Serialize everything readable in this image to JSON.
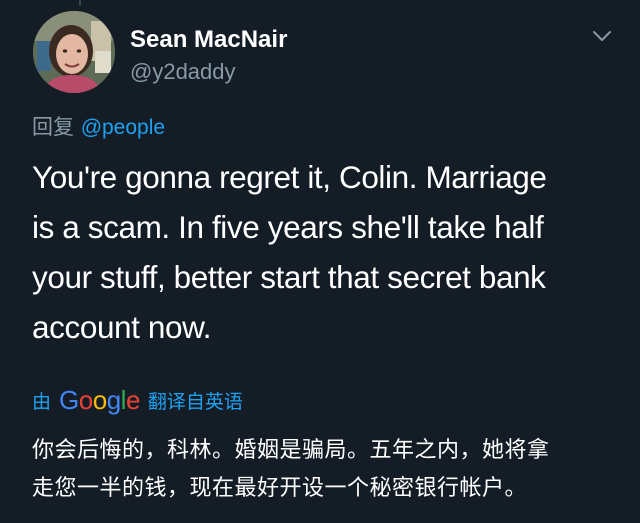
{
  "tweet": {
    "author": {
      "name": "Sean MacNair",
      "handle": "@y2daddy"
    },
    "reply": {
      "prefix": "回复",
      "mention": "@people"
    },
    "text_lines": [
      "You're gonna regret it, Colin. Marriage",
      "is a scam. In five years she'll take half",
      "your stuff, better start that secret bank",
      "account now."
    ],
    "translation": {
      "prefix": "由",
      "provider_letters": [
        "G",
        "o",
        "o",
        "g",
        "l",
        "e"
      ],
      "suffix": "翻译自英语",
      "text_lines": [
        "你会后悔的，科林。婚姻是骗局。五年之内，她将拿",
        "走您一半的钱，现在最好开设一个秘密银行帐户。"
      ]
    }
  },
  "icons": {
    "avatar": "profile-photo",
    "menu": "chevron-down-icon"
  },
  "colors": {
    "background": "#141d26",
    "text_primary": "#ffffff",
    "text_secondary": "#8899a6",
    "accent": "#1da1f2",
    "google_blue": "#4285f4",
    "google_red": "#ea4335",
    "google_yellow": "#fbbc05",
    "google_green": "#34a853"
  }
}
